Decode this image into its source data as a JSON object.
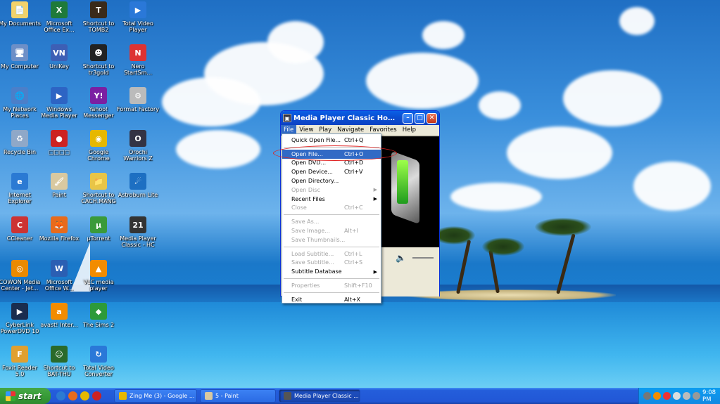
{
  "desktop": {
    "icons": [
      {
        "label": "My Documents",
        "icon": "folder-documents-icon",
        "color": "#f2d26b",
        "glyph": "📄"
      },
      {
        "label": "Microsoft Office Ex...",
        "icon": "excel-icon",
        "color": "#1f7a3a",
        "glyph": "X"
      },
      {
        "label": "Shortcut to TOMB2",
        "icon": "tomb-raider-icon",
        "color": "#3a2a1a",
        "glyph": "T"
      },
      {
        "label": "Total Video Player",
        "icon": "total-video-player-icon",
        "color": "#2a78d8",
        "glyph": "▶"
      },
      {
        "label": "My Computer",
        "icon": "computer-icon",
        "color": "#6d8fc7",
        "glyph": "🖥"
      },
      {
        "label": "UniKey",
        "icon": "unikey-icon",
        "color": "#3d5fb5",
        "glyph": "VN"
      },
      {
        "label": "Shortcut to tr3gold",
        "icon": "tr3gold-icon",
        "color": "#222",
        "glyph": "☻"
      },
      {
        "label": "Nero StartSm...",
        "icon": "nero-icon",
        "color": "#d33",
        "glyph": "N"
      },
      {
        "label": "My Network Places",
        "icon": "network-places-icon",
        "color": "#4b7fc9",
        "glyph": "🌐"
      },
      {
        "label": "Windows Media Player",
        "icon": "windows-media-player-icon",
        "color": "#2d64c4",
        "glyph": "▶"
      },
      {
        "label": "Yahoo! Messenger",
        "icon": "yahoo-messenger-icon",
        "color": "#7b1fa2",
        "glyph": "Y!"
      },
      {
        "label": "Format Factory",
        "icon": "format-factory-icon",
        "color": "#bbb",
        "glyph": "⚙"
      },
      {
        "label": "Recycle Bin",
        "icon": "recycle-bin-icon",
        "color": "#8fa8c8",
        "glyph": "♻"
      },
      {
        "label": "□□□□",
        "icon": "red-app-icon",
        "color": "#c22",
        "glyph": "●"
      },
      {
        "label": "Google Chrome",
        "icon": "chrome-icon",
        "color": "#e6b800",
        "glyph": "◉"
      },
      {
        "label": "Orochi Warriors Z",
        "icon": "orochi-warriors-icon",
        "color": "#334",
        "glyph": "O"
      },
      {
        "label": "Internet Explorer",
        "icon": "internet-explorer-icon",
        "color": "#2b7ad3",
        "glyph": "e"
      },
      {
        "label": "Paint",
        "icon": "paint-icon",
        "color": "#d9c9a0",
        "glyph": "🖌"
      },
      {
        "label": "Shortcut to CACH.MANG",
        "icon": "folder-icon",
        "color": "#e8c547",
        "glyph": "📁"
      },
      {
        "label": "Astroburn Lite",
        "icon": "astroburn-icon",
        "color": "#1d6fc2",
        "glyph": "☄"
      },
      {
        "label": "CCleaner",
        "icon": "ccleaner-icon",
        "color": "#c33",
        "glyph": "C"
      },
      {
        "label": "Mozilla Firefox",
        "icon": "firefox-icon",
        "color": "#e86b1c",
        "glyph": "🦊"
      },
      {
        "label": "µTorrent",
        "icon": "utorrent-icon",
        "color": "#3a9a3a",
        "glyph": "µ"
      },
      {
        "label": "Media Player Classic - HC",
        "icon": "mpc-hc-icon",
        "color": "#333",
        "glyph": "21"
      },
      {
        "label": "COWON Media Center - Jet...",
        "icon": "cowon-icon",
        "color": "#ea8a00",
        "glyph": "◎"
      },
      {
        "label": "Microsoft Office W...",
        "icon": "word-icon",
        "color": "#2b5fb3",
        "glyph": "W"
      },
      {
        "label": "VLC media player",
        "icon": "vlc-icon",
        "color": "#f28c00",
        "glyph": "▲"
      },
      {
        "label": "",
        "icon": "",
        "color": "",
        "glyph": ""
      },
      {
        "label": "CyberLink PowerDVD 10",
        "icon": "powerdvd-icon",
        "color": "#1a2d4f",
        "glyph": "▶"
      },
      {
        "label": "avast! Inter...",
        "icon": "avast-icon",
        "color": "#f28c00",
        "glyph": "a"
      },
      {
        "label": "The Sims 2",
        "icon": "sims2-icon",
        "color": "#2d9a3a",
        "glyph": "◆"
      },
      {
        "label": "",
        "icon": "",
        "color": "",
        "glyph": ""
      },
      {
        "label": "Foxit Reader 5.0",
        "icon": "foxit-reader-icon",
        "color": "#e0a030",
        "glyph": "F"
      },
      {
        "label": "Shortcut to BAT-THU",
        "icon": "bat-thu-icon",
        "color": "#2a6a2a",
        "glyph": "☺"
      },
      {
        "label": "Total Video Converter",
        "icon": "total-video-converter-icon",
        "color": "#2a78d8",
        "glyph": "↻"
      },
      {
        "label": "",
        "icon": "",
        "color": "",
        "glyph": ""
      }
    ]
  },
  "window": {
    "title": "Media Player Classic Home Cin...",
    "menu": [
      "File",
      "View",
      "Play",
      "Navigate",
      "Favorites",
      "Help"
    ],
    "active_menu": "File"
  },
  "file_menu": {
    "items": [
      {
        "label": "Quick Open File...",
        "shortcut": "Ctrl+Q",
        "state": "normal"
      },
      {
        "sep": true
      },
      {
        "label": "Open File...",
        "shortcut": "Ctrl+O",
        "state": "highlight"
      },
      {
        "label": "Open DVD...",
        "shortcut": "Ctrl+D",
        "state": "normal"
      },
      {
        "label": "Open Device...",
        "shortcut": "Ctrl+V",
        "state": "normal"
      },
      {
        "label": "Open Directory...",
        "shortcut": "",
        "state": "normal"
      },
      {
        "label": "Open Disc",
        "shortcut": "",
        "state": "disabled",
        "submenu": true
      },
      {
        "label": "Recent Files",
        "shortcut": "",
        "state": "normal",
        "submenu": true
      },
      {
        "label": "Close",
        "shortcut": "Ctrl+C",
        "state": "disabled"
      },
      {
        "sep": true
      },
      {
        "label": "Save As...",
        "shortcut": "",
        "state": "disabled"
      },
      {
        "label": "Save Image...",
        "shortcut": "Alt+I",
        "state": "disabled"
      },
      {
        "label": "Save Thumbnails...",
        "shortcut": "",
        "state": "disabled"
      },
      {
        "sep": true
      },
      {
        "label": "Load Subtitle...",
        "shortcut": "Ctrl+L",
        "state": "disabled"
      },
      {
        "label": "Save Subtitle...",
        "shortcut": "Ctrl+S",
        "state": "disabled"
      },
      {
        "label": "Subtitle Database",
        "shortcut": "",
        "state": "normal",
        "submenu": true
      },
      {
        "sep": true
      },
      {
        "label": "Properties",
        "shortcut": "Shift+F10",
        "state": "disabled"
      },
      {
        "sep": true
      },
      {
        "label": "Exit",
        "shortcut": "Alt+X",
        "state": "normal"
      }
    ]
  },
  "taskbar": {
    "start_label": "start",
    "tasks": [
      {
        "label": "Zing Me (3) - Google ...",
        "icon_color": "#e6b800",
        "active": false
      },
      {
        "label": "5 - Paint",
        "icon_color": "#d9c9a0",
        "active": false
      },
      {
        "label": "Media Player Classic ...",
        "icon_color": "#555",
        "active": true
      }
    ],
    "clock": "9:08 PM"
  },
  "colors": {
    "highlight": "#316ac5",
    "annotation_circle": "#e02020"
  }
}
